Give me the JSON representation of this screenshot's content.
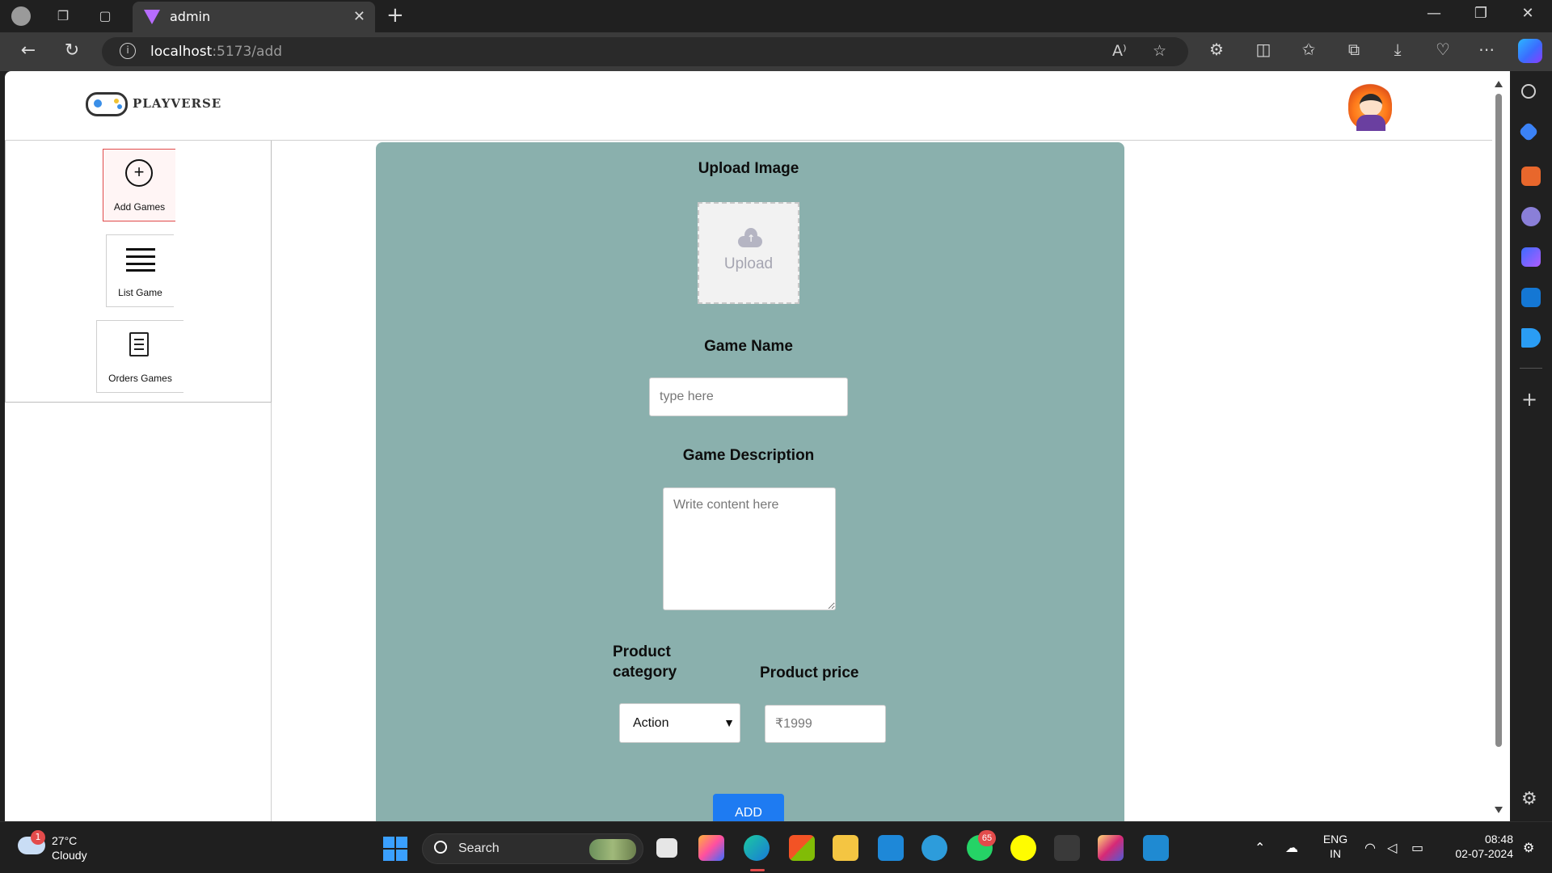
{
  "browser": {
    "tab_title": "admin",
    "url_host": "localhost",
    "url_path": ":5173/add",
    "tab_close": "✕",
    "new_tab": "+",
    "read_aloud": "A⁾"
  },
  "app": {
    "brand": "PLAYVERSE",
    "sidebar": {
      "items": [
        {
          "label": "Add Games",
          "icon": "plus-circle-icon",
          "active": true
        },
        {
          "label": "List Game",
          "icon": "list-icon",
          "active": false
        },
        {
          "label": "Orders Games",
          "icon": "order-document-icon",
          "active": false
        }
      ]
    },
    "form": {
      "upload_label": "Upload Image",
      "upload_text": "Upload",
      "name_label": "Game Name",
      "name_placeholder": "type here",
      "description_label": "Game Description",
      "description_placeholder": "Write content here",
      "category_label": "Product category",
      "category_value": "Action",
      "price_label": "Product price",
      "price_placeholder": "₹1999",
      "submit_label": "ADD"
    },
    "colors": {
      "form_background": "#8ab0ad",
      "submit_button": "#1e7bf2",
      "active_border": "#e04b4b"
    }
  },
  "taskbar": {
    "weather_badge": "1",
    "temperature": "27°C",
    "condition": "Cloudy",
    "search_label": "Search",
    "whatsapp_badge": "65",
    "language_line1": "ENG",
    "language_line2": "IN",
    "time": "08:48",
    "date": "02-07-2024"
  }
}
